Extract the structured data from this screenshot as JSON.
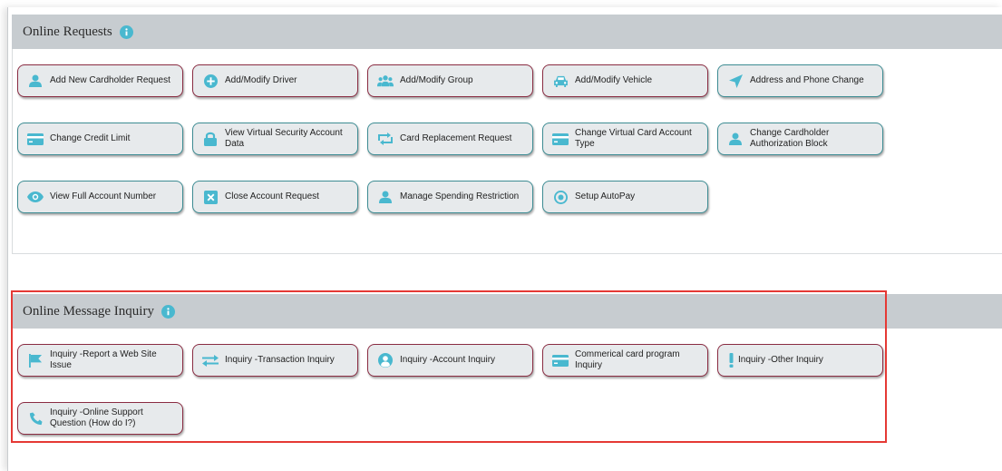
{
  "colors": {
    "icon": "#49b8cf",
    "teal_border": "#3d8c93",
    "maroon_border": "#8a2c42",
    "header_bg": "#c7ccd0",
    "highlight": "#e53935"
  },
  "online_requests": {
    "title": "Online Requests",
    "buttons": [
      {
        "label": "Add New Cardholder Request",
        "icon": "person-icon"
      },
      {
        "label": "Add/Modify Driver",
        "icon": "plus-circle-icon"
      },
      {
        "label": "Add/Modify Group",
        "icon": "group-icon"
      },
      {
        "label": "Add/Modify Vehicle",
        "icon": "car-icon"
      },
      {
        "label": "Address and Phone Change",
        "icon": "location-arrow-icon"
      },
      {
        "label": "Change Credit Limit",
        "icon": "credit-card-icon"
      },
      {
        "label": "View Virtual Security Account Data",
        "icon": "lock-icon"
      },
      {
        "label": "Card Replacement Request",
        "icon": "swap-arrows-icon"
      },
      {
        "label": "Change Virtual Card Account Type",
        "icon": "credit-card-icon"
      },
      {
        "label": "Change Cardholder Authorization Block",
        "icon": "person-icon"
      },
      {
        "label": "View Full Account Number",
        "icon": "eye-icon"
      },
      {
        "label": "Close Account Request",
        "icon": "close-square-icon"
      },
      {
        "label": "Manage Spending Restriction",
        "icon": "person-icon"
      },
      {
        "label": "Setup AutoPay",
        "icon": "target-circle-icon"
      }
    ]
  },
  "online_message_inquiry": {
    "title": "Online Message Inquiry",
    "buttons": [
      {
        "label": "Inquiry -Report a Web Site Issue",
        "icon": "flag-icon"
      },
      {
        "label": "Inquiry -Transaction Inquiry",
        "icon": "exchange-icon"
      },
      {
        "label": "Inquiry -Account Inquiry",
        "icon": "user-circle-icon"
      },
      {
        "label": "Commerical card program Inquiry",
        "icon": "credit-card-icon"
      },
      {
        "label": "Inquiry -Other Inquiry",
        "icon": "exclamation-icon"
      },
      {
        "label": "Inquiry -Online Support Question (How do I?)",
        "icon": "phone-icon"
      }
    ]
  }
}
